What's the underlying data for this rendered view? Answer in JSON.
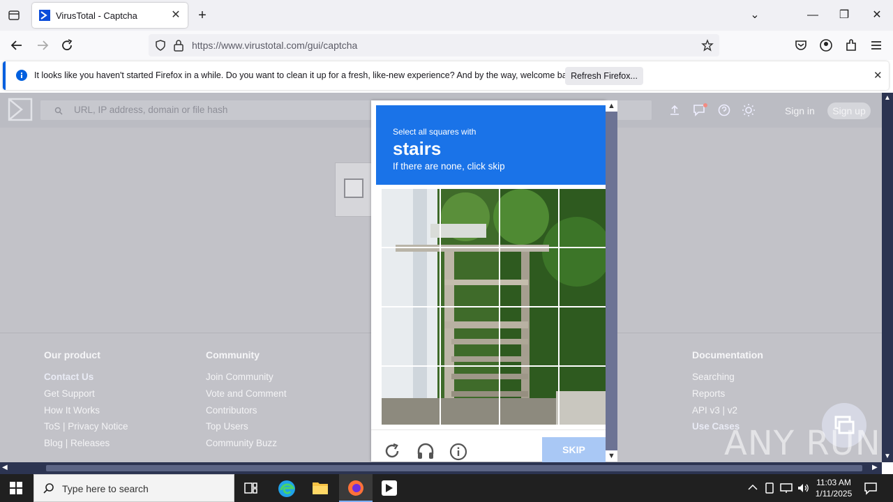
{
  "browser": {
    "tab_title": "VirusTotal - Captcha",
    "url": "https://www.virustotal.com/gui/captcha",
    "notification": {
      "text": "It looks like you haven't started Firefox in a while. Do you want to clean it up for a fresh, like-new experience? And by the way, welcome back!",
      "button": "Refresh Firefox..."
    }
  },
  "vt": {
    "search_placeholder": "URL, IP address, domain or file hash",
    "sign_in": "Sign in",
    "sign_up": "Sign up"
  },
  "footer": {
    "columns": [
      {
        "title": "Our product",
        "links": [
          "Contact Us",
          "Get Support",
          "How It Works",
          "ToS | Privacy Notice",
          "Blog | Releases"
        ]
      },
      {
        "title": "Community",
        "links": [
          "Join Community",
          "Vote and Comment",
          "Contributors",
          "Top Users",
          "Community Buzz"
        ]
      },
      {
        "title": "Documentation",
        "links": [
          "Searching",
          "Reports",
          "API v3 | v2",
          "Use Cases"
        ]
      }
    ]
  },
  "captcha": {
    "instruction": "Select all squares with",
    "target": "stairs",
    "hint": "If there are none, click skip",
    "skip": "SKIP"
  },
  "taskbar": {
    "search_placeholder": "Type here to search",
    "time": "11:03 AM",
    "date": "1/11/2025"
  },
  "watermark": "ANY RUN"
}
